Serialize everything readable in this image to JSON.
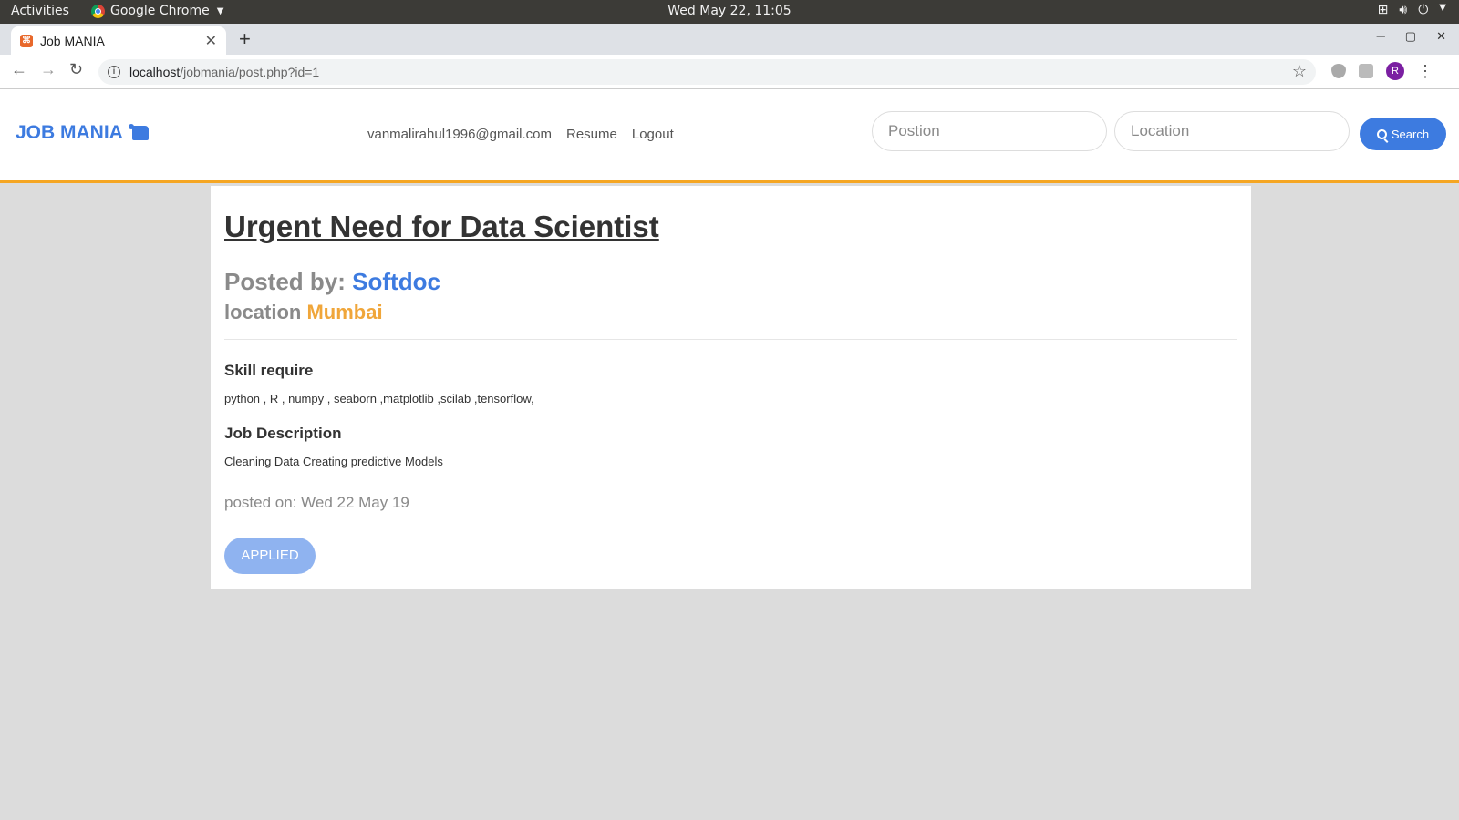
{
  "os": {
    "activities": "Activities",
    "app_name": "Google Chrome",
    "clock": "Wed May 22, 11:05"
  },
  "browser": {
    "tab_title": "Job MANIA",
    "url_host": "localhost",
    "url_path": "/jobmania/post.php?id=1",
    "avatar_letter": "R"
  },
  "site": {
    "brand": "JOB MANIA",
    "nav": {
      "email": "vanmalirahul1996@gmail.com",
      "resume": "Resume",
      "logout": "Logout"
    },
    "search": {
      "position_placeholder": "Postion",
      "location_placeholder": "Location",
      "button_label": "Search"
    }
  },
  "job": {
    "title": "Urgent Need for Data Scientist",
    "posted_by_label": "Posted by:",
    "company": "Softdoc",
    "location_label": "location",
    "city": "Mumbai",
    "skills_heading": "Skill require",
    "skills": "python , R , numpy , seaborn ,matplotlib ,scilab ,tensorflow,",
    "description_heading": "Job Description",
    "description": "Cleaning Data Creating predictive Models",
    "posted_on": "posted on: Wed 22 May 19",
    "applied_label": "APPLIED"
  },
  "colors": {
    "brand_blue": "#3d7be0",
    "accent_orange": "#f5a623",
    "city_orange": "#f0a63a",
    "applied_button": "#8fb3f0"
  }
}
